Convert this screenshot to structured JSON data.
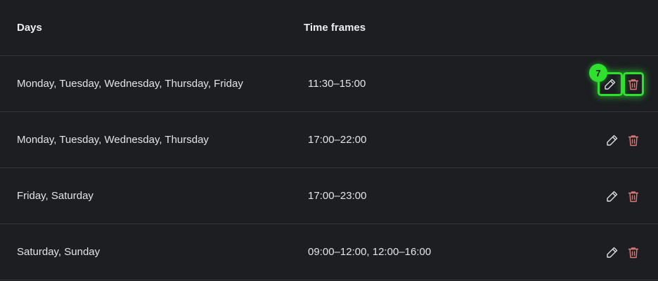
{
  "table": {
    "headers": {
      "days": "Days",
      "time_frames": "Time frames"
    },
    "rows": [
      {
        "days": "Monday, Tuesday, Wednesday, Thursday, Friday",
        "time_frames": "11:30–15:00"
      },
      {
        "days": "Monday, Tuesday, Wednesday, Thursday",
        "time_frames": "17:00–22:00"
      },
      {
        "days": "Friday, Saturday",
        "time_frames": "17:00–23:00"
      },
      {
        "days": "Saturday, Sunday",
        "time_frames": "09:00–12:00, 12:00–16:00"
      }
    ]
  },
  "annotation": {
    "badge_label": "7",
    "highlight_color": "#2fe02f"
  },
  "icons": {
    "edit": "pencil-icon",
    "delete": "trash-icon"
  },
  "colors": {
    "background": "#1c1e22",
    "divider": "#31343a",
    "delete_icon": "#e07a74"
  }
}
